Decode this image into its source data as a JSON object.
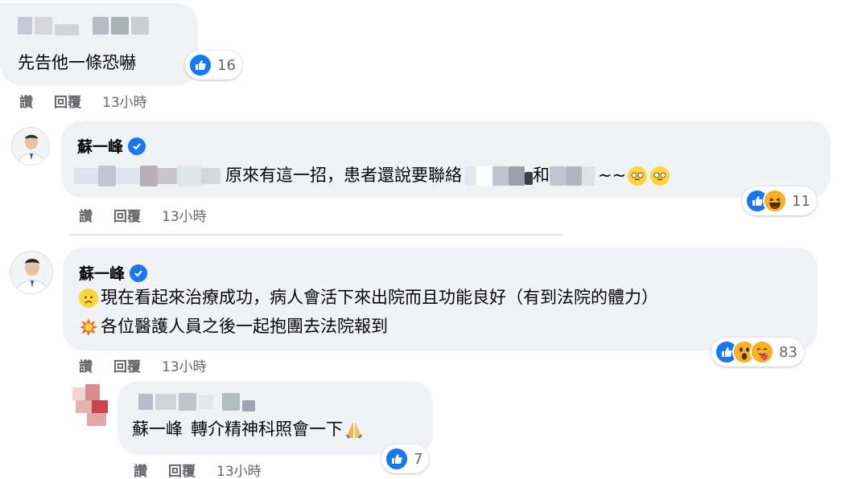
{
  "comments": [
    {
      "text": "先告他一條恐嚇",
      "reaction_count": "16",
      "actions": {
        "like": "讚",
        "reply": "回覆",
        "time": "13小時"
      }
    },
    {
      "author": "蘇一峰",
      "text_mid": "原來有這一招，患者還說要聯絡",
      "text_and": "和",
      "text_tail": "~~",
      "reaction_count": "11",
      "actions": {
        "like": "讚",
        "reply": "回覆",
        "time": "13小時"
      }
    },
    {
      "author": "蘇一峰",
      "line1": "現在看起來治療成功，病人會活下來出院而且功能良好（有到法院的體力）",
      "line2": "各位醫護人員之後一起抱團去法院報到",
      "reaction_count": "83",
      "actions": {
        "like": "讚",
        "reply": "回覆",
        "time": "13小時"
      }
    },
    {
      "mention": "蘇一峰",
      "text": "轉介精神科照會一下",
      "reaction_count": "7",
      "actions": {
        "like": "讚",
        "reply": "回覆",
        "time": "13小時"
      }
    }
  ],
  "colors": {
    "bubble": "#f0f2f5",
    "like_blue": "#1877f2",
    "meta_gray": "#65676b"
  },
  "icons": [
    "like-icon",
    "haha-icon",
    "wow-icon",
    "care-icon",
    "verified-badge-icon",
    "pleading-face-emoji",
    "sad-face-emoji",
    "explosion-emoji",
    "folded-hands-emoji"
  ]
}
